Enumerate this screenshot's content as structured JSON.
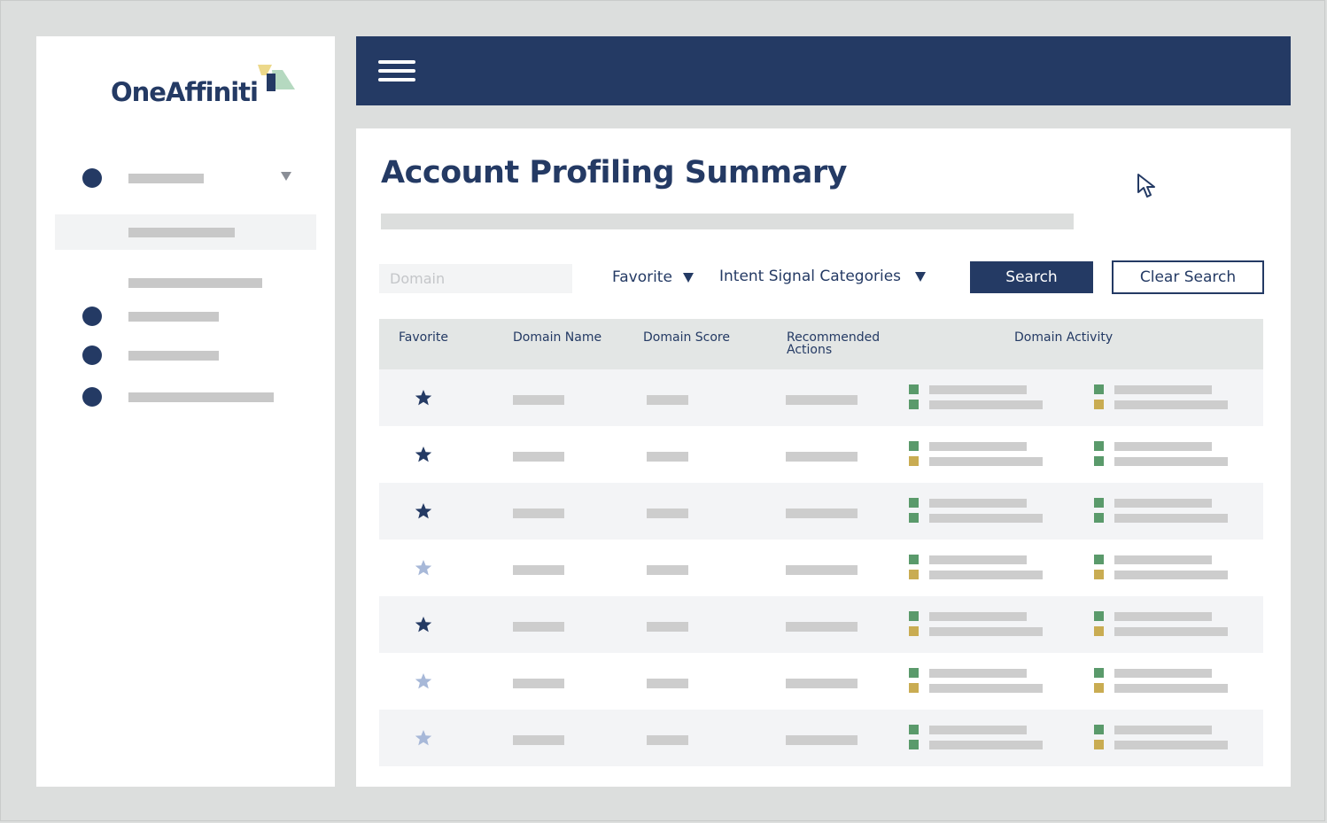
{
  "brand": {
    "logo_text": "OneAffiniti",
    "colors": {
      "primary": "#243a64",
      "logo_yellow": "#ecd88a",
      "logo_green": "#b5d9c0"
    }
  },
  "header": {
    "menu_icon": "hamburger-icon"
  },
  "page": {
    "title": "Account Profiling Summary"
  },
  "filters": {
    "domain_placeholder": "Domain",
    "favorite_label": "Favorite",
    "intent_label": "Intent Signal Categories",
    "search_label": "Search",
    "clear_label": "Clear Search"
  },
  "table": {
    "columns": {
      "favorite": "Favorite",
      "domain_name": "Domain Name",
      "domain_score": "Domain Score",
      "recommended_actions": "Recommended Actions",
      "domain_activity": "Domain Activity"
    },
    "rows": [
      {
        "favorite": true,
        "activity": [
          "green",
          "green",
          "green",
          "yellow"
        ]
      },
      {
        "favorite": true,
        "activity": [
          "green",
          "yellow",
          "green",
          "green"
        ]
      },
      {
        "favorite": true,
        "activity": [
          "green",
          "green",
          "green",
          "green"
        ]
      },
      {
        "favorite": false,
        "activity": [
          "green",
          "yellow",
          "green",
          "yellow"
        ]
      },
      {
        "favorite": true,
        "activity": [
          "green",
          "yellow",
          "green",
          "yellow"
        ]
      },
      {
        "favorite": false,
        "activity": [
          "green",
          "yellow",
          "green",
          "yellow"
        ]
      },
      {
        "favorite": false,
        "activity": [
          "green",
          "green",
          "green",
          "yellow"
        ]
      }
    ],
    "status_colors": {
      "green": "#5a9a6b",
      "yellow": "#c9ac52"
    },
    "star_colors": {
      "favorite": "#243a64",
      "not_favorite": "#a7b8d8"
    }
  }
}
